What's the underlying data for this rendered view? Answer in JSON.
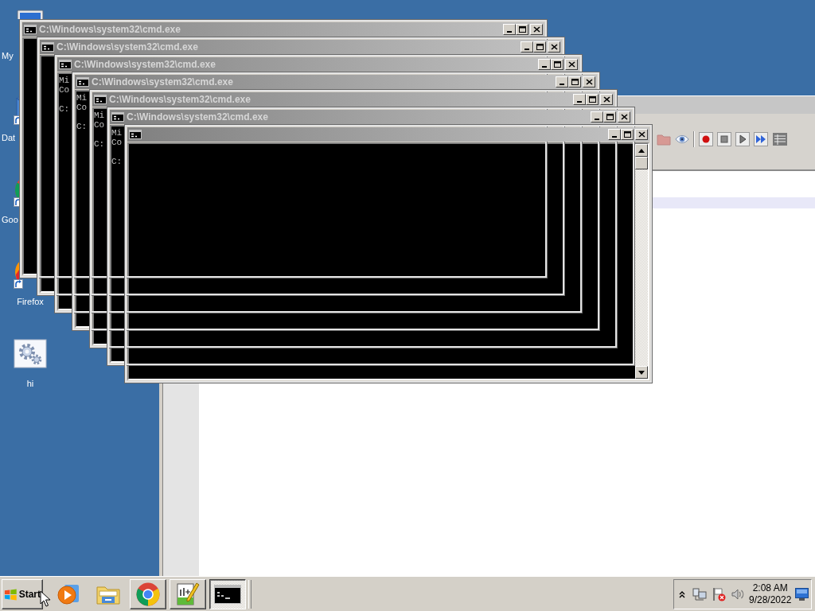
{
  "desktop": {
    "icons": [
      {
        "kind": "computer",
        "label": "My",
        "shortcut": false
      },
      {
        "kind": "database",
        "label": "Dat",
        "shortcut": true
      },
      {
        "kind": "ring",
        "label": "Goo",
        "shortcut": true
      },
      {
        "kind": "globe",
        "label": "Firefox",
        "shortcut": true
      },
      {
        "kind": "gear",
        "label": "hi",
        "shortcut": false
      }
    ]
  },
  "app_window": {
    "toolbar": [
      {
        "kind": "folder",
        "disabled": true
      },
      {
        "kind": "eye",
        "disabled": false
      },
      {
        "kind": "separator"
      },
      {
        "kind": "record",
        "disabled": false
      },
      {
        "kind": "stop",
        "disabled": false
      },
      {
        "kind": "play",
        "disabled": false
      },
      {
        "kind": "forward",
        "disabled": false
      },
      {
        "kind": "table",
        "disabled": false
      }
    ]
  },
  "console_windows": [
    {
      "title": "C:\\Windows\\system32\\cmd.exe"
    },
    {
      "title": "C:\\Windows\\system32\\cmd.exe"
    },
    {
      "title": "C:\\Windows\\system32\\cmd.exe",
      "console": {
        "lines": [
          "Mi",
          "Co"
        ],
        "prompt": "C:"
      }
    },
    {
      "title": "C:\\Windows\\system32\\cmd.exe",
      "console": {
        "lines": [
          "Mi",
          "Co"
        ],
        "prompt": "C:"
      }
    },
    {
      "title": "C:\\Windows\\system32\\cmd.exe",
      "console": {
        "lines": [
          "Mi",
          "Co"
        ],
        "prompt": "C:"
      }
    },
    {
      "title": "C:\\Windows\\system32\\cmd.exe",
      "console": {
        "lines": [
          "Mi",
          "Co"
        ],
        "prompt": "C:"
      }
    },
    {
      "scrollbar": true
    }
  ],
  "taskbar": {
    "start": "Start",
    "tasks": [
      {
        "kind": "browser",
        "selected": false
      },
      {
        "kind": "editor",
        "selected": false
      },
      {
        "kind": "console",
        "selected": true
      }
    ],
    "clock": {
      "time": "2:08 AM",
      "date": "9/28/2022"
    }
  }
}
